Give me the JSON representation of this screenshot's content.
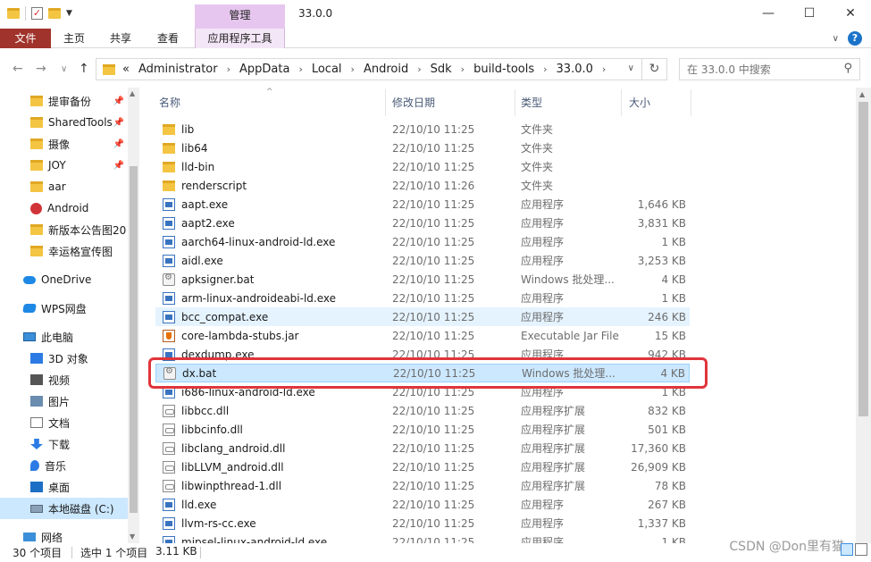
{
  "window": {
    "title": "33.0.0",
    "context_group": "管理",
    "controls": {
      "minimize": "—",
      "maximize": "☐",
      "close": "✕"
    }
  },
  "ribbon": {
    "tabs": [
      {
        "label": "文件"
      },
      {
        "label": "主页"
      },
      {
        "label": "共享"
      },
      {
        "label": "查看"
      },
      {
        "label": "应用程序工具"
      }
    ],
    "expand_icon": "chevron-down-icon",
    "help": "?"
  },
  "address": {
    "overflow": "«",
    "crumbs": [
      "Administrator",
      "AppData",
      "Local",
      "Android",
      "Sdk",
      "build-tools",
      "33.0.0"
    ],
    "search_placeholder": "在 33.0.0 中搜索"
  },
  "nav": {
    "items": [
      {
        "label": "提审备份",
        "icon": "folder-icon",
        "pinned": true
      },
      {
        "label": "SharedTools",
        "icon": "synced-folder-icon",
        "pinned": true
      },
      {
        "label": "摄像",
        "icon": "folder-icon",
        "pinned": true
      },
      {
        "label": "JOY",
        "icon": "folder-icon",
        "pinned": true
      },
      {
        "label": "aar",
        "icon": "folder-icon",
        "pinned": false
      },
      {
        "label": "Android",
        "icon": "error-folder-icon",
        "pinned": false
      },
      {
        "label": "新版本公告图20",
        "icon": "folder-icon",
        "pinned": false
      },
      {
        "label": "幸运格宣传图",
        "icon": "folder-icon",
        "pinned": false
      },
      {
        "label": "OneDrive",
        "icon": "onedrive-icon",
        "pinned": false
      },
      {
        "label": "WPS网盘",
        "icon": "wps-cloud-icon",
        "pinned": false
      },
      {
        "label": "此电脑",
        "icon": "computer-icon",
        "pinned": false
      },
      {
        "label": "3D 对象",
        "icon": "3d-objects-icon",
        "pinned": false
      },
      {
        "label": "视频",
        "icon": "video-icon",
        "pinned": false
      },
      {
        "label": "图片",
        "icon": "pictures-icon",
        "pinned": false
      },
      {
        "label": "文档",
        "icon": "documents-icon",
        "pinned": false
      },
      {
        "label": "下载",
        "icon": "download-icon",
        "pinned": false
      },
      {
        "label": "音乐",
        "icon": "music-icon",
        "pinned": false
      },
      {
        "label": "桌面",
        "icon": "desktop-icon",
        "pinned": false
      },
      {
        "label": "本地磁盘 (C:)",
        "icon": "drive-icon",
        "pinned": false,
        "selected": true
      },
      {
        "label": "网络",
        "icon": "network-icon",
        "pinned": false
      }
    ]
  },
  "columns": {
    "name": "名称",
    "date": "修改日期",
    "type": "类型",
    "size": "大小"
  },
  "files": [
    {
      "name": "lib",
      "date": "22/10/10 11:25",
      "type": "文件夹",
      "size": "",
      "kind": "folder"
    },
    {
      "name": "lib64",
      "date": "22/10/10 11:25",
      "type": "文件夹",
      "size": "",
      "kind": "folder"
    },
    {
      "name": "lld-bin",
      "date": "22/10/10 11:25",
      "type": "文件夹",
      "size": "",
      "kind": "folder"
    },
    {
      "name": "renderscript",
      "date": "22/10/10 11:26",
      "type": "文件夹",
      "size": "",
      "kind": "folder"
    },
    {
      "name": "aapt.exe",
      "date": "22/10/10 11:25",
      "type": "应用程序",
      "size": "1,646 KB",
      "kind": "exe"
    },
    {
      "name": "aapt2.exe",
      "date": "22/10/10 11:25",
      "type": "应用程序",
      "size": "3,831 KB",
      "kind": "exe"
    },
    {
      "name": "aarch64-linux-android-ld.exe",
      "date": "22/10/10 11:25",
      "type": "应用程序",
      "size": "1 KB",
      "kind": "exe"
    },
    {
      "name": "aidl.exe",
      "date": "22/10/10 11:25",
      "type": "应用程序",
      "size": "3,253 KB",
      "kind": "exe"
    },
    {
      "name": "apksigner.bat",
      "date": "22/10/10 11:25",
      "type": "Windows 批处理...",
      "size": "4 KB",
      "kind": "bat"
    },
    {
      "name": "arm-linux-androideabi-ld.exe",
      "date": "22/10/10 11:25",
      "type": "应用程序",
      "size": "1 KB",
      "kind": "exe"
    },
    {
      "name": "bcc_compat.exe",
      "date": "22/10/10 11:25",
      "type": "应用程序",
      "size": "246 KB",
      "kind": "exe",
      "state": "hover"
    },
    {
      "name": "core-lambda-stubs.jar",
      "date": "22/10/10 11:25",
      "type": "Executable Jar File",
      "size": "15 KB",
      "kind": "jar"
    },
    {
      "name": "dexdump.exe",
      "date": "22/10/10 11:25",
      "type": "应用程序",
      "size": "942 KB",
      "kind": "exe"
    },
    {
      "name": "dx.bat",
      "date": "22/10/10 11:25",
      "type": "Windows 批处理...",
      "size": "4 KB",
      "kind": "bat",
      "state": "selected"
    },
    {
      "name": "i686-linux-android-ld.exe",
      "date": "22/10/10 11:25",
      "type": "应用程序",
      "size": "1 KB",
      "kind": "exe"
    },
    {
      "name": "libbcc.dll",
      "date": "22/10/10 11:25",
      "type": "应用程序扩展",
      "size": "832 KB",
      "kind": "dll"
    },
    {
      "name": "libbcinfo.dll",
      "date": "22/10/10 11:25",
      "type": "应用程序扩展",
      "size": "501 KB",
      "kind": "dll"
    },
    {
      "name": "libclang_android.dll",
      "date": "22/10/10 11:25",
      "type": "应用程序扩展",
      "size": "17,360 KB",
      "kind": "dll"
    },
    {
      "name": "libLLVM_android.dll",
      "date": "22/10/10 11:25",
      "type": "应用程序扩展",
      "size": "26,909 KB",
      "kind": "dll"
    },
    {
      "name": "libwinpthread-1.dll",
      "date": "22/10/10 11:25",
      "type": "应用程序扩展",
      "size": "78 KB",
      "kind": "dll"
    },
    {
      "name": "lld.exe",
      "date": "22/10/10 11:25",
      "type": "应用程序",
      "size": "267 KB",
      "kind": "exe"
    },
    {
      "name": "llvm-rs-cc.exe",
      "date": "22/10/10 11:25",
      "type": "应用程序",
      "size": "1,337 KB",
      "kind": "exe"
    },
    {
      "name": "mipsel-linux-android-ld.exe",
      "date": "22/10/10 11:25",
      "type": "应用程序",
      "size": "1 KB",
      "kind": "exe"
    }
  ],
  "status": {
    "count": "30 个项目",
    "selection": "选中 1 个项目",
    "size": "3.11 KB"
  },
  "watermark": "CSDN @Don里有猫",
  "colors": {
    "file_tab": "#a0332b",
    "context_group": "#e6c6ee",
    "selection": "#cce8ff",
    "hover": "#e5f3ff",
    "annotation": "#e0353b"
  }
}
